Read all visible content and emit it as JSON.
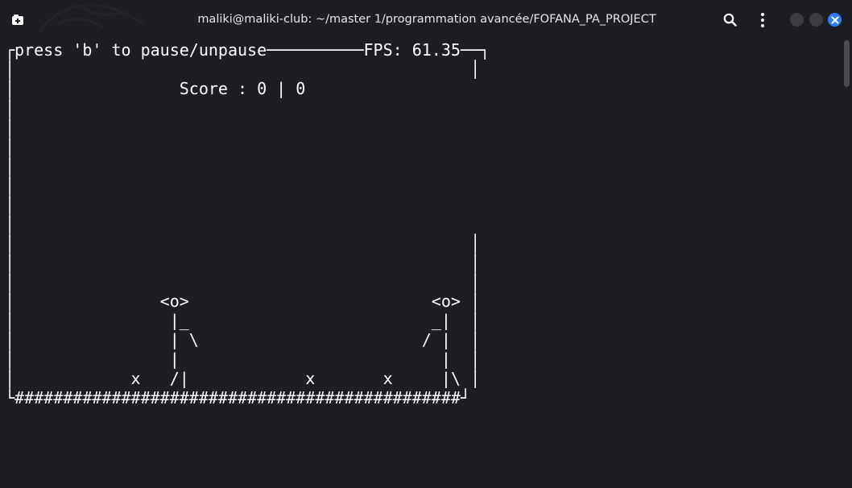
{
  "titlebar": {
    "title": "maliki@maliki-club: ~/master 1/programmation avancée/FOFANA_PA_PROJECT",
    "icons": [
      "new-tab-icon",
      "search-icon",
      "kebab-menu-icon",
      "minimize-icon",
      "maximize-icon",
      "close-icon"
    ]
  },
  "colors": {
    "background": "#1c1e24",
    "text": "#ffffff",
    "close_button": "#2f7cf6"
  },
  "game": {
    "pause_hint": "press 'b' to pause/unpause",
    "fps_label": "FPS: 61.35",
    "score_label": "Score : 0 | 0",
    "lines": [
      "┌press 'b' to pause/unpause──────────FPS: 61.35──┐",
      "│                                               │",
      "│                 Score : 0 | 0                  ",
      "│                                                ",
      "│                                                ",
      "│                                                ",
      "│                                                ",
      "│                                                ",
      "│                                                ",
      "│                                                ",
      "│                                               │",
      "│                                               │",
      "│                                               │",
      "│               <o>                         <o> │",
      "│                |_                         _|  │",
      "│                | \\                       / |  │",
      "│                |                           |  │",
      "│            x   /|            x       x     |\\ │",
      "└##############################################┘"
    ]
  }
}
